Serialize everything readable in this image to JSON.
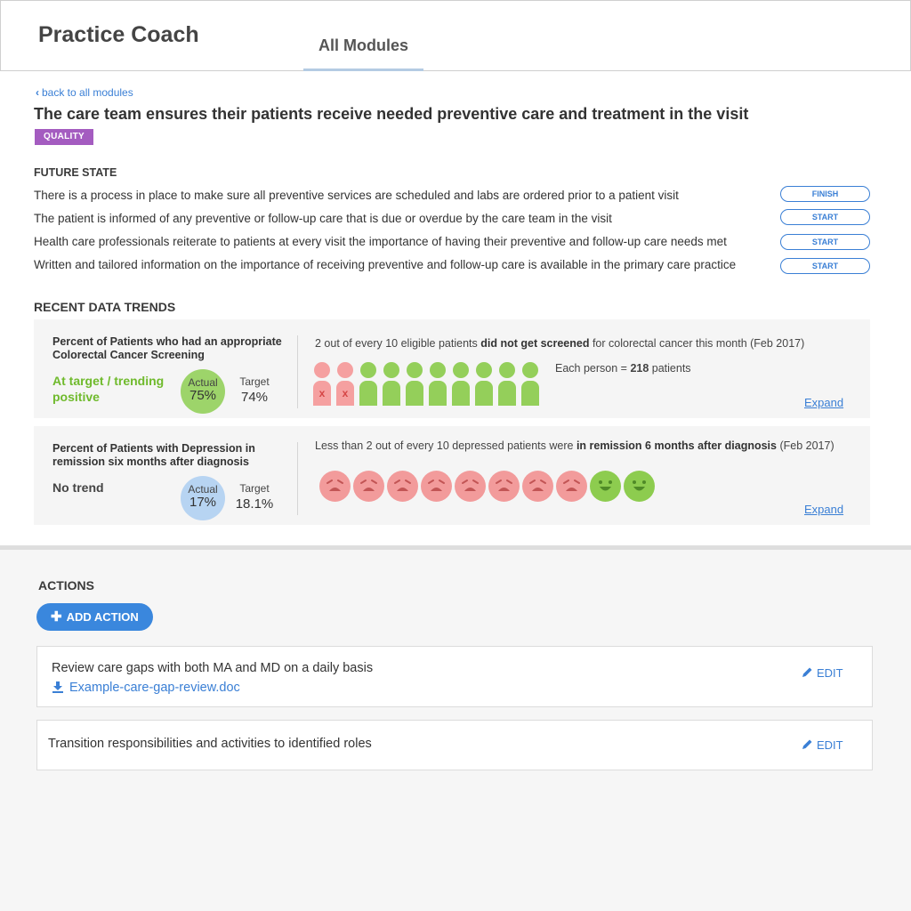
{
  "header": {
    "app_title": "Practice Coach",
    "active_tab": "All Modules"
  },
  "module": {
    "back_link": "back to all modules",
    "title": "The care team ensures their patients receive needed preventive care and treatment in the visit",
    "badge": "QUALITY",
    "badge_color": "#a45cc0"
  },
  "future_state": {
    "heading": "FUTURE STATE",
    "items": [
      {
        "text": "There is a process in place to make sure all preventive services are scheduled and labs are ordered prior to a patient visit",
        "button": "FINISH"
      },
      {
        "text": "The patient is informed of any preventive or follow-up care that is due or overdue by the care team in the visit",
        "button": "START"
      },
      {
        "text": "Health care professionals reiterate to patients at every visit the importance of having their preventive and follow-up care needs met",
        "button": "START"
      },
      {
        "text": "Written and tailored information on the importance of receiving preventive and follow-up care is available in the primary care practice",
        "button": "START"
      }
    ]
  },
  "trends": {
    "heading": "RECENT DATA TRENDS",
    "cards": [
      {
        "metric": "Percent of Patients who had an appropriate Colorectal Cancer Screening",
        "status": "At target / trending positive",
        "status_color": "#6fba2c",
        "actual_label": "Actual",
        "actual_value": "75%",
        "actual_color": "#9dd46a",
        "target_label": "Target",
        "target_value": "74%",
        "summary_pre": "2 out of every 10 eligible patients ",
        "summary_bold": "did not get screened",
        "summary_post": " for colorectal cancer this month (Feb 2017)",
        "people_missed": 2,
        "people_total": 10,
        "missed_mark": "x",
        "per_person_pre": "Each person = ",
        "per_person_value": "218",
        "per_person_post": " patients",
        "expand": "Expand"
      },
      {
        "metric": "Percent of Patients with Depression in remission six months after diagnosis",
        "status": "No trend",
        "status_color": "#444444",
        "actual_label": "Actual",
        "actual_value": "17%",
        "actual_color": "#b7d4f2",
        "target_label": "Target",
        "target_value": "18.1%",
        "summary_pre": "Less than 2 out of every 10 depressed patients were ",
        "summary_bold": "in remission 6 months after diagnosis",
        "summary_post": " (Feb 2017)",
        "faces_sad": 8,
        "faces_happy": 2,
        "expand": "Expand"
      }
    ]
  },
  "actions": {
    "heading": "ACTIONS",
    "add_label": "ADD ACTION",
    "items": [
      {
        "text": "Review care gaps with both MA and MD on a daily basis",
        "attachment": "Example-care-gap-review.doc",
        "edit": "EDIT"
      },
      {
        "text": "Transition responsibilities and activities to identified roles",
        "edit": "EDIT"
      }
    ]
  }
}
